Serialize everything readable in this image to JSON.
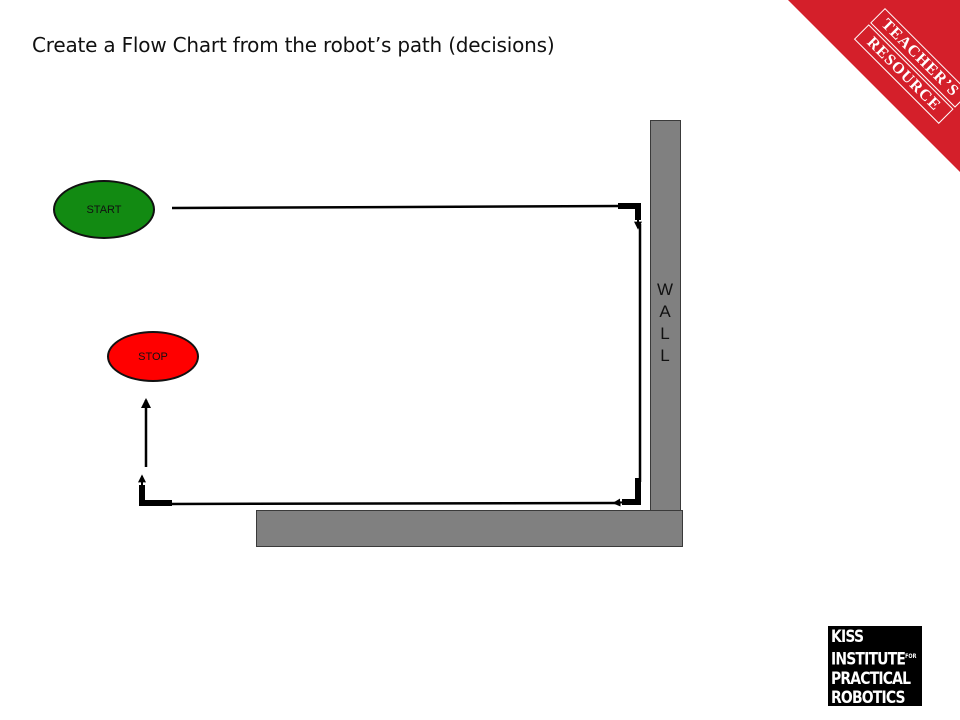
{
  "title": "Create a Flow Chart from the robot’s path (decisions)",
  "ribbon": {
    "line1": "TEACHER’S",
    "line2": "RESOURCE",
    "color": "#d41f2a"
  },
  "diagram": {
    "start_label": "START",
    "stop_label": "STOP",
    "wall_letters": [
      "W",
      "A",
      "L",
      "L"
    ],
    "colors": {
      "start": "#128a12",
      "stop": "#ff0000",
      "wall": "#808080"
    }
  },
  "logo": {
    "line1": "KISS",
    "line2": "INSTITUTE",
    "line2_sup": "FOR",
    "line3": "PRACTICAL",
    "line4": "ROBOTICS"
  }
}
